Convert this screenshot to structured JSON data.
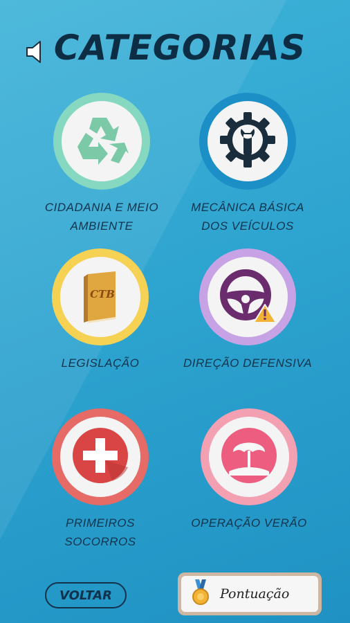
{
  "header": {
    "title": "CATEGORIAS",
    "sound_icon": "speaker-icon"
  },
  "categories": [
    {
      "label": "CIDADANIA E MEIO AMBIENTE",
      "icon": "recycle-icon",
      "ring_color": "#86d9c0",
      "icon_color": "#7cc9a7"
    },
    {
      "label": "MECÂNICA BÁSICA DOS VEÍCULOS",
      "icon": "wrench-gear-icon",
      "ring_color": "#1c8fc6",
      "icon_color": "#1a2d3c"
    },
    {
      "label": "LEGISLAÇÃO",
      "icon": "ctb-book-icon",
      "book_text": "CTB",
      "ring_color": "#f6d254",
      "icon_color": "#e0a640"
    },
    {
      "label": "DIREÇÃO DEFENSIVA",
      "icon": "steering-wheel-warning-icon",
      "ring_color": "#c7a3e6",
      "icon_color": "#6b2c6e"
    },
    {
      "label": "PRIMEIROS SOCORROS",
      "icon": "first-aid-cross-icon",
      "ring_color": "#e66a66",
      "icon_color": "#d94444"
    },
    {
      "label": "OPERAÇÃO VERÃO",
      "icon": "beach-umbrella-icon",
      "ring_color": "#f4a0b3",
      "icon_color": "#ec5d80"
    }
  ],
  "footer": {
    "back_label": "VOLTAR",
    "score_label": "Pontuação",
    "score_icon": "medal-icon"
  },
  "colors": {
    "background": "#2ea4d0",
    "title": "#0d2d45"
  }
}
